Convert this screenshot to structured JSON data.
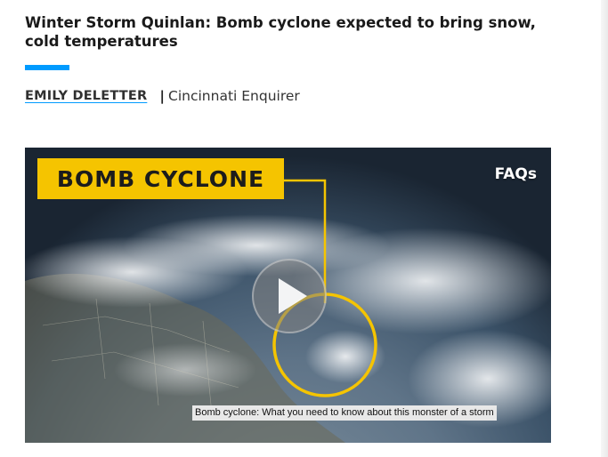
{
  "article": {
    "headline": "Winter Storm Quinlan: Bomb cyclone expected to bring snow, cold temperatures",
    "author": "EMILY DELETTER",
    "separator": "|",
    "publisher": "Cincinnati Enquirer"
  },
  "video": {
    "label": "BOMB CYCLONE",
    "badge": "FAQs",
    "caption": "Bomb cyclone: What you need to know about this monster of a storm",
    "play_icon": "play-icon"
  },
  "colors": {
    "accent": "#009bff",
    "label_yellow": "#f5c400",
    "ring_yellow": "#f5c400"
  }
}
